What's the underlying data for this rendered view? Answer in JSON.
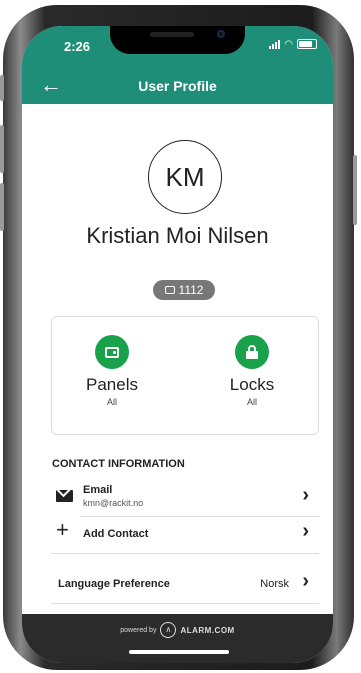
{
  "status_bar": {
    "time": "2:26"
  },
  "header": {
    "back_icon": "arrow-left-icon",
    "title": "User Profile"
  },
  "profile": {
    "initials": "KM",
    "name": "Kristian Moi Nilsen",
    "user_code": "1112"
  },
  "access": [
    {
      "label": "Panels",
      "sub": "All",
      "icon": "panel-icon"
    },
    {
      "label": "Locks",
      "sub": "All",
      "icon": "lock-icon"
    }
  ],
  "contact": {
    "header": "CONTACT INFORMATION",
    "email": {
      "label": "Email",
      "value": "kmn@rackit.no"
    },
    "add_contact": "Add Contact"
  },
  "language": {
    "label": "Language Preference",
    "value": "Norsk"
  },
  "footer": {
    "powered_by": "powered by",
    "brand": "ALARM.COM"
  },
  "colors": {
    "header_green": "#1e8e78",
    "icon_green": "#19a24b",
    "footer_dark": "#2b2b2b"
  }
}
